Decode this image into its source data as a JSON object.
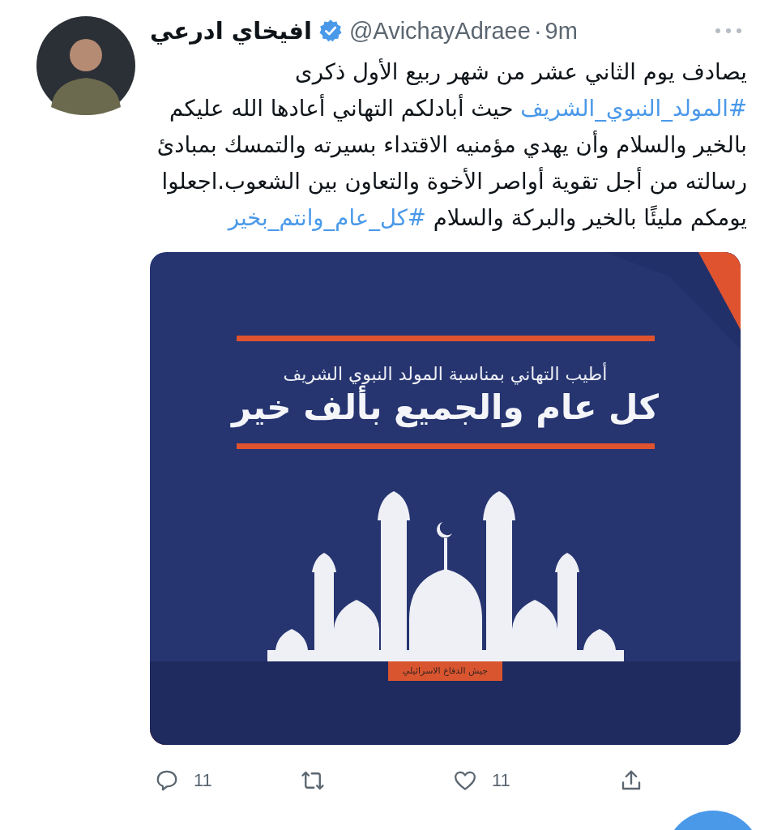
{
  "tweet": {
    "author": {
      "name": "افيخاي ادرعي",
      "verified": true,
      "handle": "@AvichayAdraee",
      "separator": "·",
      "time": "9m"
    },
    "text": [
      {
        "kind": "text",
        "text": "يصادف يوم الثاني عشر من شهر ربيع الأول ذكرى "
      },
      {
        "kind": "hashtag",
        "text": "#المولد_النبوي_الشريف"
      },
      {
        "kind": "text",
        "text": " حيث أبادلكم التهاني أعادها الله عليكم بالخير والسلام وأن يهدي مؤمنيه الاقتداء بسيرته والتمسك بمبادئ رسالته من أجل تقوية أواصر الأخوة والتعاون بين الشعوب.اجعلوا يومكم مليئًا بالخير والبركة والسلام "
      },
      {
        "kind": "hashtag",
        "text": "#كل_عام_وانتم_بخير"
      }
    ],
    "image": {
      "subtitle": "أطيب التهاني بمناسبة المولد النبوي الشريف",
      "headline": "كل عام والجميع بألف خير",
      "logo_label": "جيش الدفاع الاسرائيلي"
    },
    "reply_count": "11",
    "like_count": "11"
  }
}
